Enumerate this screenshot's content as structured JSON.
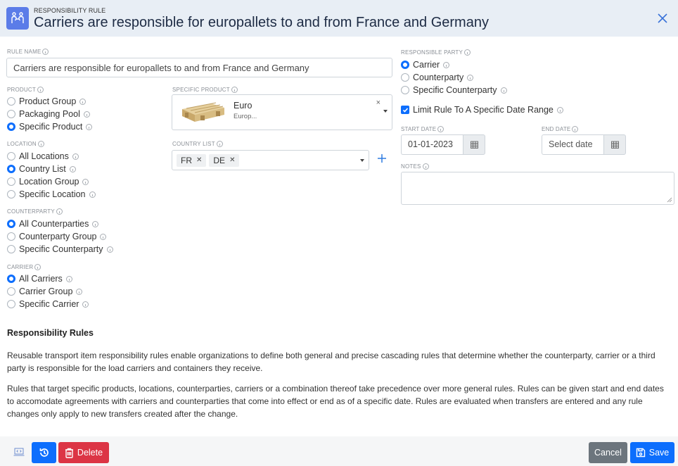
{
  "header": {
    "subtitle": "RESPONSIBILITY RULE",
    "title": "Carriers are responsible for europallets to and from France and Germany",
    "icon": "people-handshake-icon",
    "close_icon": "close-icon"
  },
  "form": {
    "rule_name": {
      "label": "RULE NAME",
      "value": "Carriers are responsible for europallets to and from France and Germany"
    },
    "product": {
      "label": "PRODUCT",
      "options": [
        {
          "label": "Product Group",
          "selected": false
        },
        {
          "label": "Packaging Pool",
          "selected": false
        },
        {
          "label": "Specific Product",
          "selected": true
        }
      ]
    },
    "specific_product": {
      "label": "SPECIFIC PRODUCT",
      "name": "Euro",
      "description": "Europ...",
      "image": "pallet-image"
    },
    "location": {
      "label": "LOCATION",
      "options": [
        {
          "label": "All Locations",
          "selected": false
        },
        {
          "label": "Country List",
          "selected": true
        },
        {
          "label": "Location Group",
          "selected": false
        },
        {
          "label": "Specific Location",
          "selected": false
        }
      ]
    },
    "country_list": {
      "label": "COUNTRY LIST",
      "tags": [
        "FR",
        "DE"
      ],
      "add_icon": "plus-icon"
    },
    "counterparty": {
      "label": "COUNTERPARTY",
      "options": [
        {
          "label": "All Counterparties",
          "selected": true
        },
        {
          "label": "Counterparty Group",
          "selected": false
        },
        {
          "label": "Specific Counterparty",
          "selected": false
        }
      ]
    },
    "carrier": {
      "label": "CARRIER",
      "options": [
        {
          "label": "All Carriers",
          "selected": true
        },
        {
          "label": "Carrier Group",
          "selected": false
        },
        {
          "label": "Specific Carrier",
          "selected": false
        }
      ]
    },
    "responsible_party": {
      "label": "RESPONSIBLE PARTY",
      "options": [
        {
          "label": "Carrier",
          "selected": true
        },
        {
          "label": "Counterparty",
          "selected": false
        },
        {
          "label": "Specific Counterparty",
          "selected": false
        }
      ]
    },
    "limit_date_range": {
      "label": "Limit Rule To A Specific Date Range",
      "checked": true
    },
    "start_date": {
      "label": "START DATE",
      "value": "01-01-2023"
    },
    "end_date": {
      "label": "END DATE",
      "placeholder": "Select date"
    },
    "notes": {
      "label": "NOTES",
      "value": ""
    }
  },
  "help": {
    "title": "Responsibility Rules",
    "paragraphs": [
      "Reusable transport item responsibility rules enable organizations to define both general and precise cascading rules that determine whether the counterparty, carrier or a third party is responsible for the load carriers and containers they receive.",
      "Rules that target specific products, locations, counterparties, carriers or a combination thereof take precedence over more general rules. Rules can be given start and end dates to accomodate agreements with carriers and counterparties that come into effect or end as of a specific date. Rules are evaluated when transfers are entered and any rule changes only apply to new transfers created after the change."
    ]
  },
  "footer": {
    "code_icon": "code-laptop-icon",
    "history_icon": "history-icon",
    "delete_label": "Delete",
    "cancel_label": "Cancel",
    "save_label": "Save"
  },
  "colors": {
    "primary": "#0d6efd",
    "danger": "#dc3545",
    "secondary": "#6c757d",
    "header_bg": "#e8eef5",
    "app_icon_bg": "#5b7ce8"
  }
}
